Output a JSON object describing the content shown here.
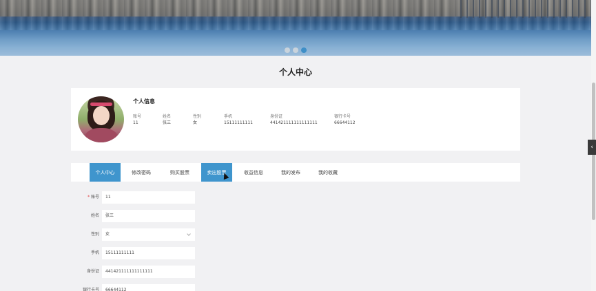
{
  "banner": {
    "dots": 3,
    "active_dot": 2
  },
  "page_title": "个人中心",
  "profile": {
    "title": "个人信息",
    "fields": [
      {
        "label": "账号",
        "value": "11"
      },
      {
        "label": "姓名",
        "value": "张三"
      },
      {
        "label": "性别",
        "value": "女"
      },
      {
        "label": "手机",
        "value": "15111111111"
      },
      {
        "label": "身份证",
        "value": "441421111111111111"
      },
      {
        "label": "银行卡号",
        "value": "66644112"
      }
    ]
  },
  "tabs": [
    {
      "label": "个人中心",
      "active": true
    },
    {
      "label": "修改密码",
      "active": false
    },
    {
      "label": "购买股票",
      "active": false
    },
    {
      "label": "卖出股票",
      "active": true
    },
    {
      "label": "收益信息",
      "active": false
    },
    {
      "label": "我的发布",
      "active": false
    },
    {
      "label": "我的收藏",
      "active": false
    }
  ],
  "form": {
    "account_label": "账号",
    "account_value": "11",
    "name_label": "姓名",
    "name_value": "张三",
    "gender_label": "性别",
    "gender_value": "女",
    "phone_label": "手机",
    "phone_value": "15111111111",
    "idcard_label": "身份证",
    "idcard_value": "441421111111111111",
    "bank_label": "银行卡号",
    "bank_value": "66644112"
  },
  "colors": {
    "accent": "#3f95cd",
    "background": "#f1f1f3",
    "required": "#e23a3a"
  }
}
